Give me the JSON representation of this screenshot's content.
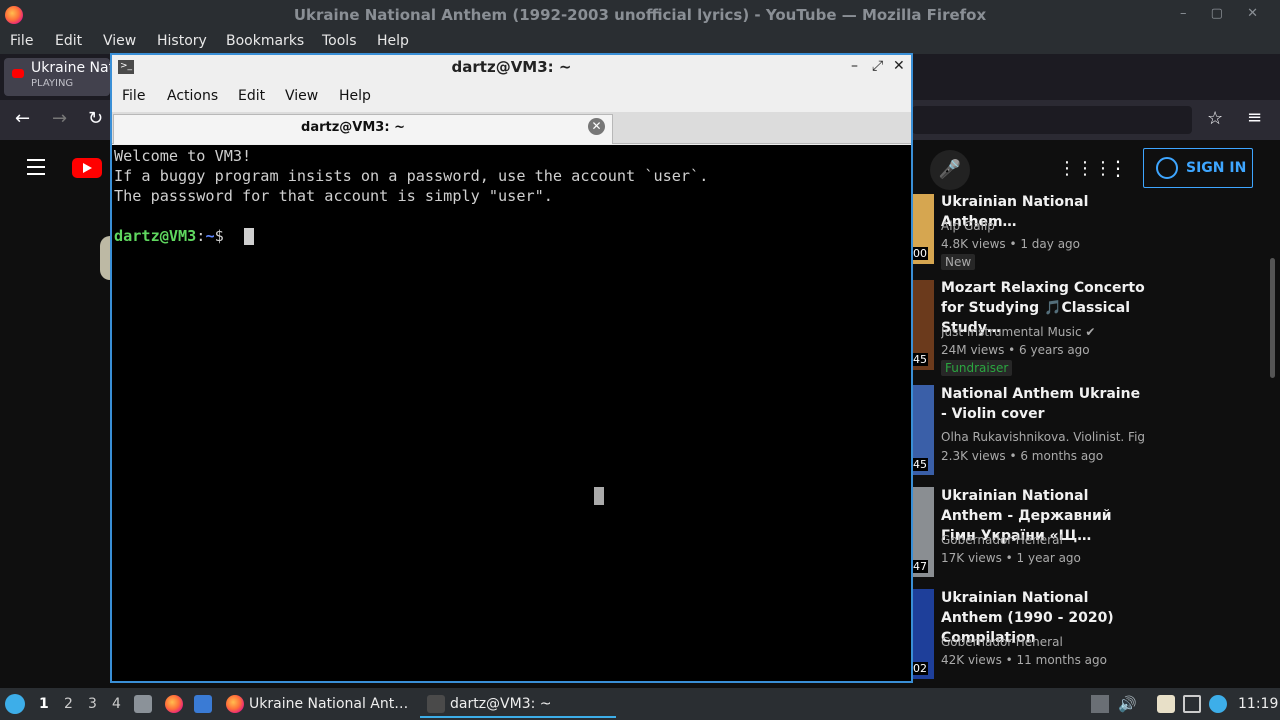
{
  "firefox": {
    "window_title": "Ukraine National Anthem (1992-2003 unofficial lyrics) - YouTube — Mozilla Firefox",
    "menu": [
      "File",
      "Edit",
      "View",
      "History",
      "Bookmarks",
      "Tools",
      "Help"
    ],
    "tab": {
      "title": "Ukraine National Anthem",
      "status": "PLAYING"
    }
  },
  "youtube": {
    "sign_in_label": "SIGN IN",
    "videos": [
      {
        "title": "Ukrainian National Anthem…",
        "channel": "Alp Galip",
        "meta": "4.8K views • 1 day ago",
        "badge": "New",
        "duration": "00"
      },
      {
        "title": "Mozart Relaxing Concerto for Studying 🎵Classical Study…",
        "channel": "Just Instrumental Music ✔",
        "meta": "24M views • 6 years ago",
        "badge": "Fundraiser",
        "duration": "45"
      },
      {
        "title": "National Anthem Ukraine - Violin cover",
        "channel": "Olha Rukavishnikova. Violinist. Fight…",
        "meta": "2.3K views • 6 months ago",
        "duration": "45"
      },
      {
        "title": "Ukrainian National Anthem - Державний Гімн України «Щ…",
        "channel": "Gobernador-Heneral",
        "meta": "17K views • 1 year ago",
        "duration": "47"
      },
      {
        "title": "Ukrainian National Anthem (1990 - 2020) Compilation",
        "channel": "Gobernador-Heneral",
        "meta": "42K views • 11 months ago",
        "duration": "02"
      }
    ]
  },
  "terminal": {
    "window_title": "dartz@VM3: ~",
    "menu": [
      "File",
      "Actions",
      "Edit",
      "View",
      "Help"
    ],
    "tab_label": "dartz@VM3: ~",
    "lines": [
      "Welcome to VM3!",
      "If a buggy program insists on a password, use the account `user`.",
      "The passsword for that account is simply \"user\"."
    ],
    "prompt": {
      "user_host": "dartz@VM3",
      "path": "~",
      "symbol": "$"
    }
  },
  "taskbar": {
    "workspaces": [
      "1",
      "2",
      "3",
      "4"
    ],
    "tasks": [
      "Ukraine National Ant…",
      "dartz@VM3: ~"
    ],
    "clock": "11:19"
  },
  "colors": {
    "accent": "#3a8fd6",
    "yt_red": "#ff0000",
    "prompt_green": "#5fd75f",
    "prompt_blue": "#5f87ff"
  }
}
